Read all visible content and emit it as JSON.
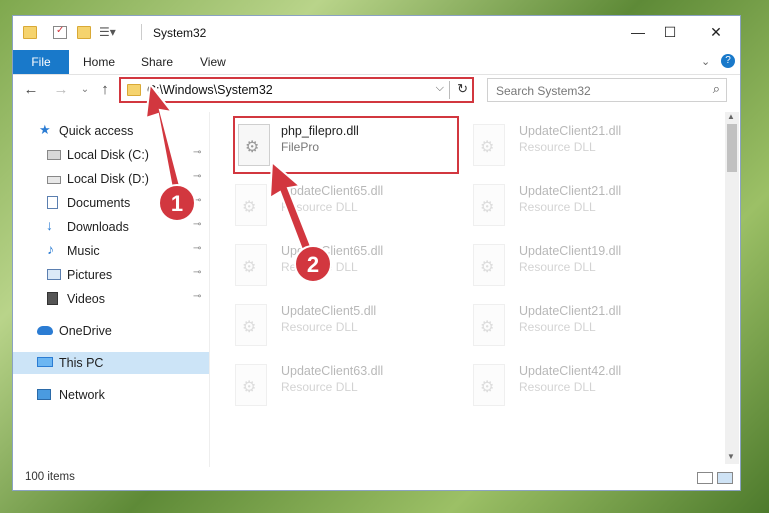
{
  "window": {
    "title": "System32",
    "tabs": {
      "file": "File",
      "home": "Home",
      "share": "Share",
      "view": "View"
    },
    "controls": {
      "minimize": "—",
      "maximize": "☐",
      "close": "✕"
    }
  },
  "address": {
    "path": "C:\\Windows\\System32",
    "dropdown": "⌵",
    "refresh": "↻"
  },
  "search": {
    "placeholder": "Search System32",
    "icon": "⌕"
  },
  "nav": {
    "back": "←",
    "forward": "→",
    "recent": "⌄",
    "up": "↑"
  },
  "sidebar": {
    "items": [
      {
        "label": "Quick access",
        "icon": "star-icon"
      },
      {
        "label": "Local Disk (C:)",
        "icon": "drive-icon",
        "pinned": true
      },
      {
        "label": "Local Disk (D:)",
        "icon": "drive-icon",
        "pinned": true
      },
      {
        "label": "Documents",
        "icon": "documents-icon",
        "pinned": true
      },
      {
        "label": "Downloads",
        "icon": "download-icon",
        "pinned": true
      },
      {
        "label": "Music",
        "icon": "music-icon",
        "pinned": true
      },
      {
        "label": "Pictures",
        "icon": "pictures-icon",
        "pinned": true
      },
      {
        "label": "Videos",
        "icon": "videos-icon",
        "pinned": true
      },
      {
        "label": "OneDrive",
        "icon": "cloud-icon"
      },
      {
        "label": "This PC",
        "icon": "pc-icon",
        "selected": true
      },
      {
        "label": "Network",
        "icon": "network-icon"
      }
    ],
    "pin_glyph": "📌"
  },
  "files": [
    {
      "name": "php_filepro.dll",
      "type": "FilePro",
      "highlighted": true
    },
    {
      "name": "UpdateClient21.dll",
      "type": "Resource DLL"
    },
    {
      "name": "UpdateClient65.dll",
      "type": "Resource DLL"
    },
    {
      "name": "UpdateClient21.dll",
      "type": "Resource DLL"
    },
    {
      "name": "UpdateClient65.dll",
      "type": "Resource DLL"
    },
    {
      "name": "UpdateClient19.dll",
      "type": "Resource DLL"
    },
    {
      "name": "UpdateClient5.dll",
      "type": "Resource DLL"
    },
    {
      "name": "UpdateClient21.dll",
      "type": "Resource DLL"
    },
    {
      "name": "UpdateClient63.dll",
      "type": "Resource DLL"
    },
    {
      "name": "UpdateClient42.dll",
      "type": "Resource DLL"
    }
  ],
  "status": {
    "count": "100 items"
  },
  "callouts": {
    "one": "1",
    "two": "2"
  },
  "colors": {
    "accent": "#1979ca",
    "highlight": "#d2373f",
    "selected": "#cce4f7"
  }
}
